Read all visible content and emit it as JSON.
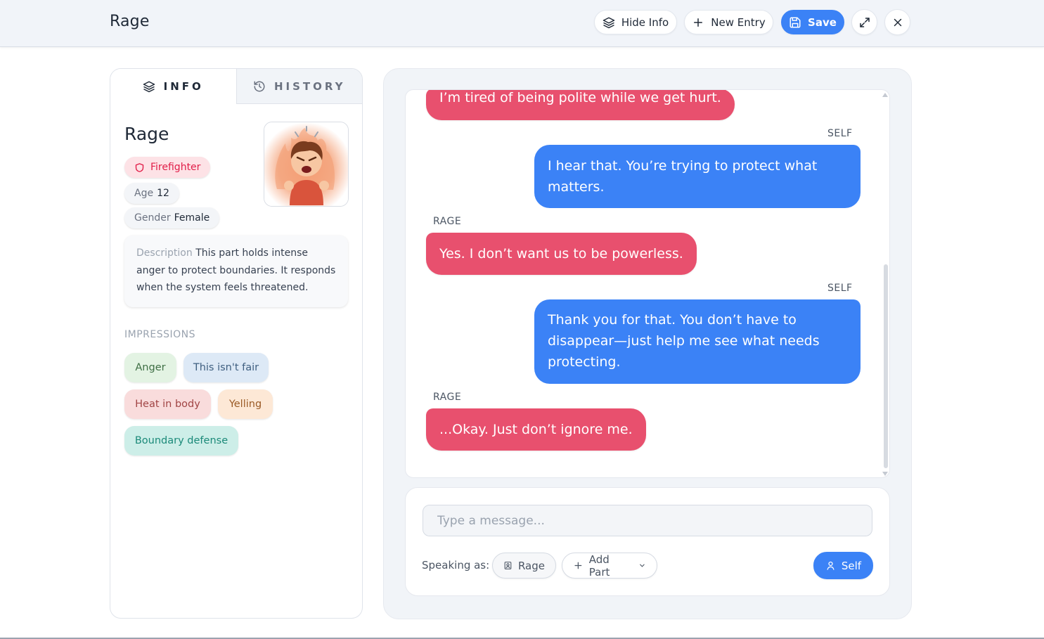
{
  "header": {
    "title": "Rage",
    "hide_info_label": "Hide Info",
    "new_entry_label": "New Entry",
    "save_label": "Save"
  },
  "left": {
    "tabs": [
      {
        "label": "INFO",
        "icon": "layers-icon",
        "active": true
      },
      {
        "label": "HISTORY",
        "icon": "history-icon",
        "active": false
      }
    ],
    "part": {
      "name": "Rage",
      "role": "Firefighter",
      "age_label": "Age",
      "age": "12",
      "gender_label": "Gender",
      "gender": "Female",
      "description_label": "Description",
      "description": "This part holds intense anger to protect boundaries. It responds when the system feels threatened."
    },
    "impressions_heading": "IMPRESSIONS",
    "impressions": [
      {
        "label": "Anger",
        "bg": "#e3f3e3",
        "color": "#3f6f45"
      },
      {
        "label": "This isn't fair",
        "bg": "#dde9f6",
        "color": "#3f5f80"
      },
      {
        "label": "Heat in body",
        "bg": "#f9dcdc",
        "color": "#a14545"
      },
      {
        "label": "Yelling",
        "bg": "#fde8d6",
        "color": "#9a5a25"
      },
      {
        "label": "Boundary defense",
        "bg": "#cdeee8",
        "color": "#1b8a79"
      }
    ]
  },
  "chat": {
    "messages": [
      {
        "speaker": "",
        "from": "rage",
        "text": "I’m tired of being polite while we get hurt."
      },
      {
        "speaker": "SELF",
        "from": "self",
        "text": "I hear that. You’re trying to protect what matters."
      },
      {
        "speaker": "RAGE",
        "from": "rage",
        "text": "Yes. I don’t want us to be powerless."
      },
      {
        "speaker": "SELF",
        "from": "self",
        "text": "Thank you for that. You don’t have to disappear—just help me see what needs protecting."
      },
      {
        "speaker": "RAGE",
        "from": "rage",
        "text": "...Okay. Just don’t ignore me."
      }
    ],
    "input_placeholder": "Type a message...",
    "speaking_as_label": "Speaking as:",
    "rage_part_label": "Rage",
    "add_part_label": "Add Part",
    "self_label": "Self"
  },
  "colors": {
    "accent": "#3b82f6",
    "rage_bubble": "#e8506e",
    "self_bubble": "#3b82f6"
  }
}
